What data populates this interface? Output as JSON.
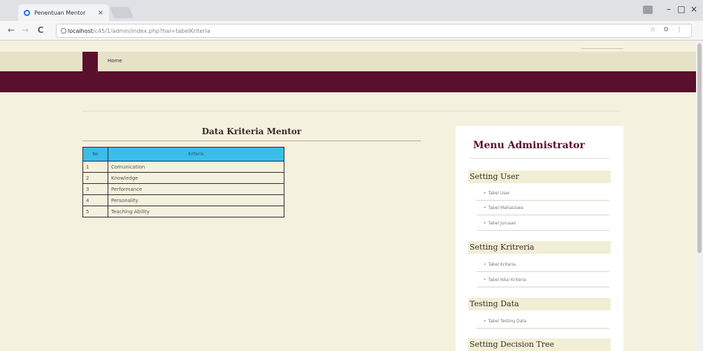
{
  "browser": {
    "tab_title": "Penentuan Mentor",
    "tab_close": "×",
    "url_host": "localhost",
    "url_path": "/c45/1/admin/index.php?hal=tabelKriteria",
    "window": {
      "minimize": "–",
      "maximize": "□",
      "close": "×"
    },
    "nav": {
      "back": "←",
      "forward": "→",
      "reload": "C"
    },
    "url_right": "☆ ⚙ ⋮"
  },
  "site": {
    "menu_home": "Home"
  },
  "main": {
    "title": "Data Kriteria Mentor",
    "table": {
      "headers": [
        "No",
        "Kriteria"
      ],
      "rows": [
        [
          "1",
          "Comunication"
        ],
        [
          "2",
          "Knowledge"
        ],
        [
          "3",
          "Performance"
        ],
        [
          "4",
          "Personality"
        ],
        [
          "5",
          "Teaching Ability"
        ]
      ]
    }
  },
  "sidebar": {
    "title": "Menu Administrator",
    "bullet": "•",
    "sections": [
      {
        "label": "Setting User",
        "items": [
          "Tabel User",
          "Tabel Mahasiswa",
          "Tabel Jurusan"
        ]
      },
      {
        "label": "Setting Kritreria",
        "items": [
          "Tabel Kriteria",
          "Tabel Nilai Kriteria"
        ]
      },
      {
        "label": "Testing Data",
        "items": [
          "Tabel Testing Data"
        ]
      },
      {
        "label": "Setting Decision Tree",
        "items": []
      }
    ]
  },
  "colors": {
    "brand": "#5a0f2d",
    "header_cell": "#3cbde9",
    "background": "#f4f1df"
  }
}
